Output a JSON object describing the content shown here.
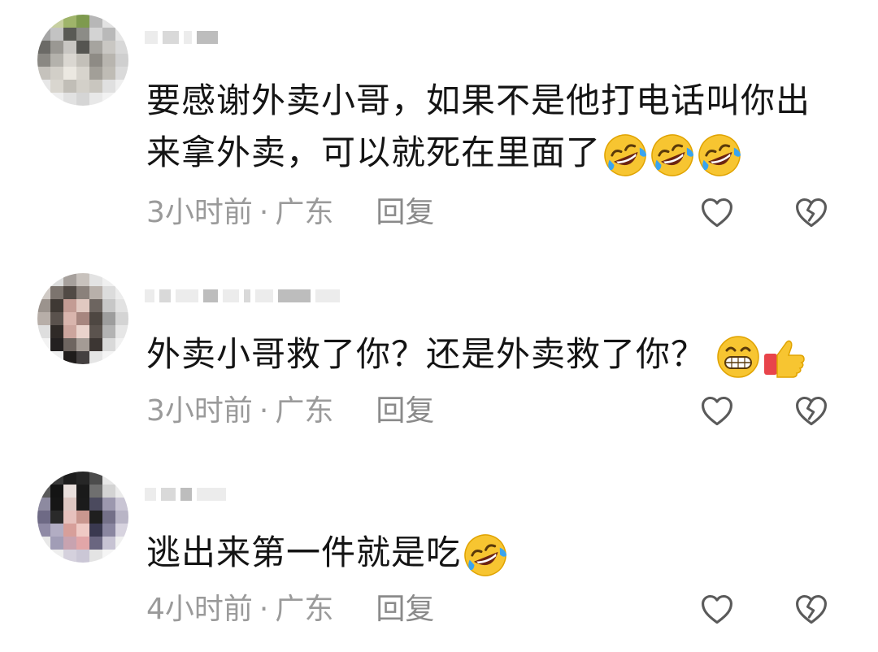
{
  "comments": [
    {
      "content": "要感谢外卖小哥，如果不是他打电话叫你出来拿外卖，可以就死在里面了",
      "emojis": [
        "rofl-emoji",
        "rofl-emoji",
        "rofl-emoji"
      ],
      "time": "3小时前",
      "location": "广东",
      "reply_label": "回复"
    },
    {
      "content": "外卖小哥救了你？还是外卖救了你？",
      "emojis": [
        "grin-emoji",
        "thumbs-up-emoji"
      ],
      "time": "3小时前",
      "location": "广东",
      "reply_label": "回复"
    },
    {
      "content": "逃出来第一件就是吃",
      "emojis": [
        "rofl-emoji"
      ],
      "time": "4小时前",
      "location": "广东",
      "reply_label": "回复"
    }
  ],
  "meta_separator": "·",
  "icons": {
    "like": "heart-outline-icon",
    "dislike": "broken-heart-outline-icon"
  },
  "colors": {
    "text": "#141414",
    "meta": "#9a9a9a",
    "icon": "#5a5a5a"
  }
}
